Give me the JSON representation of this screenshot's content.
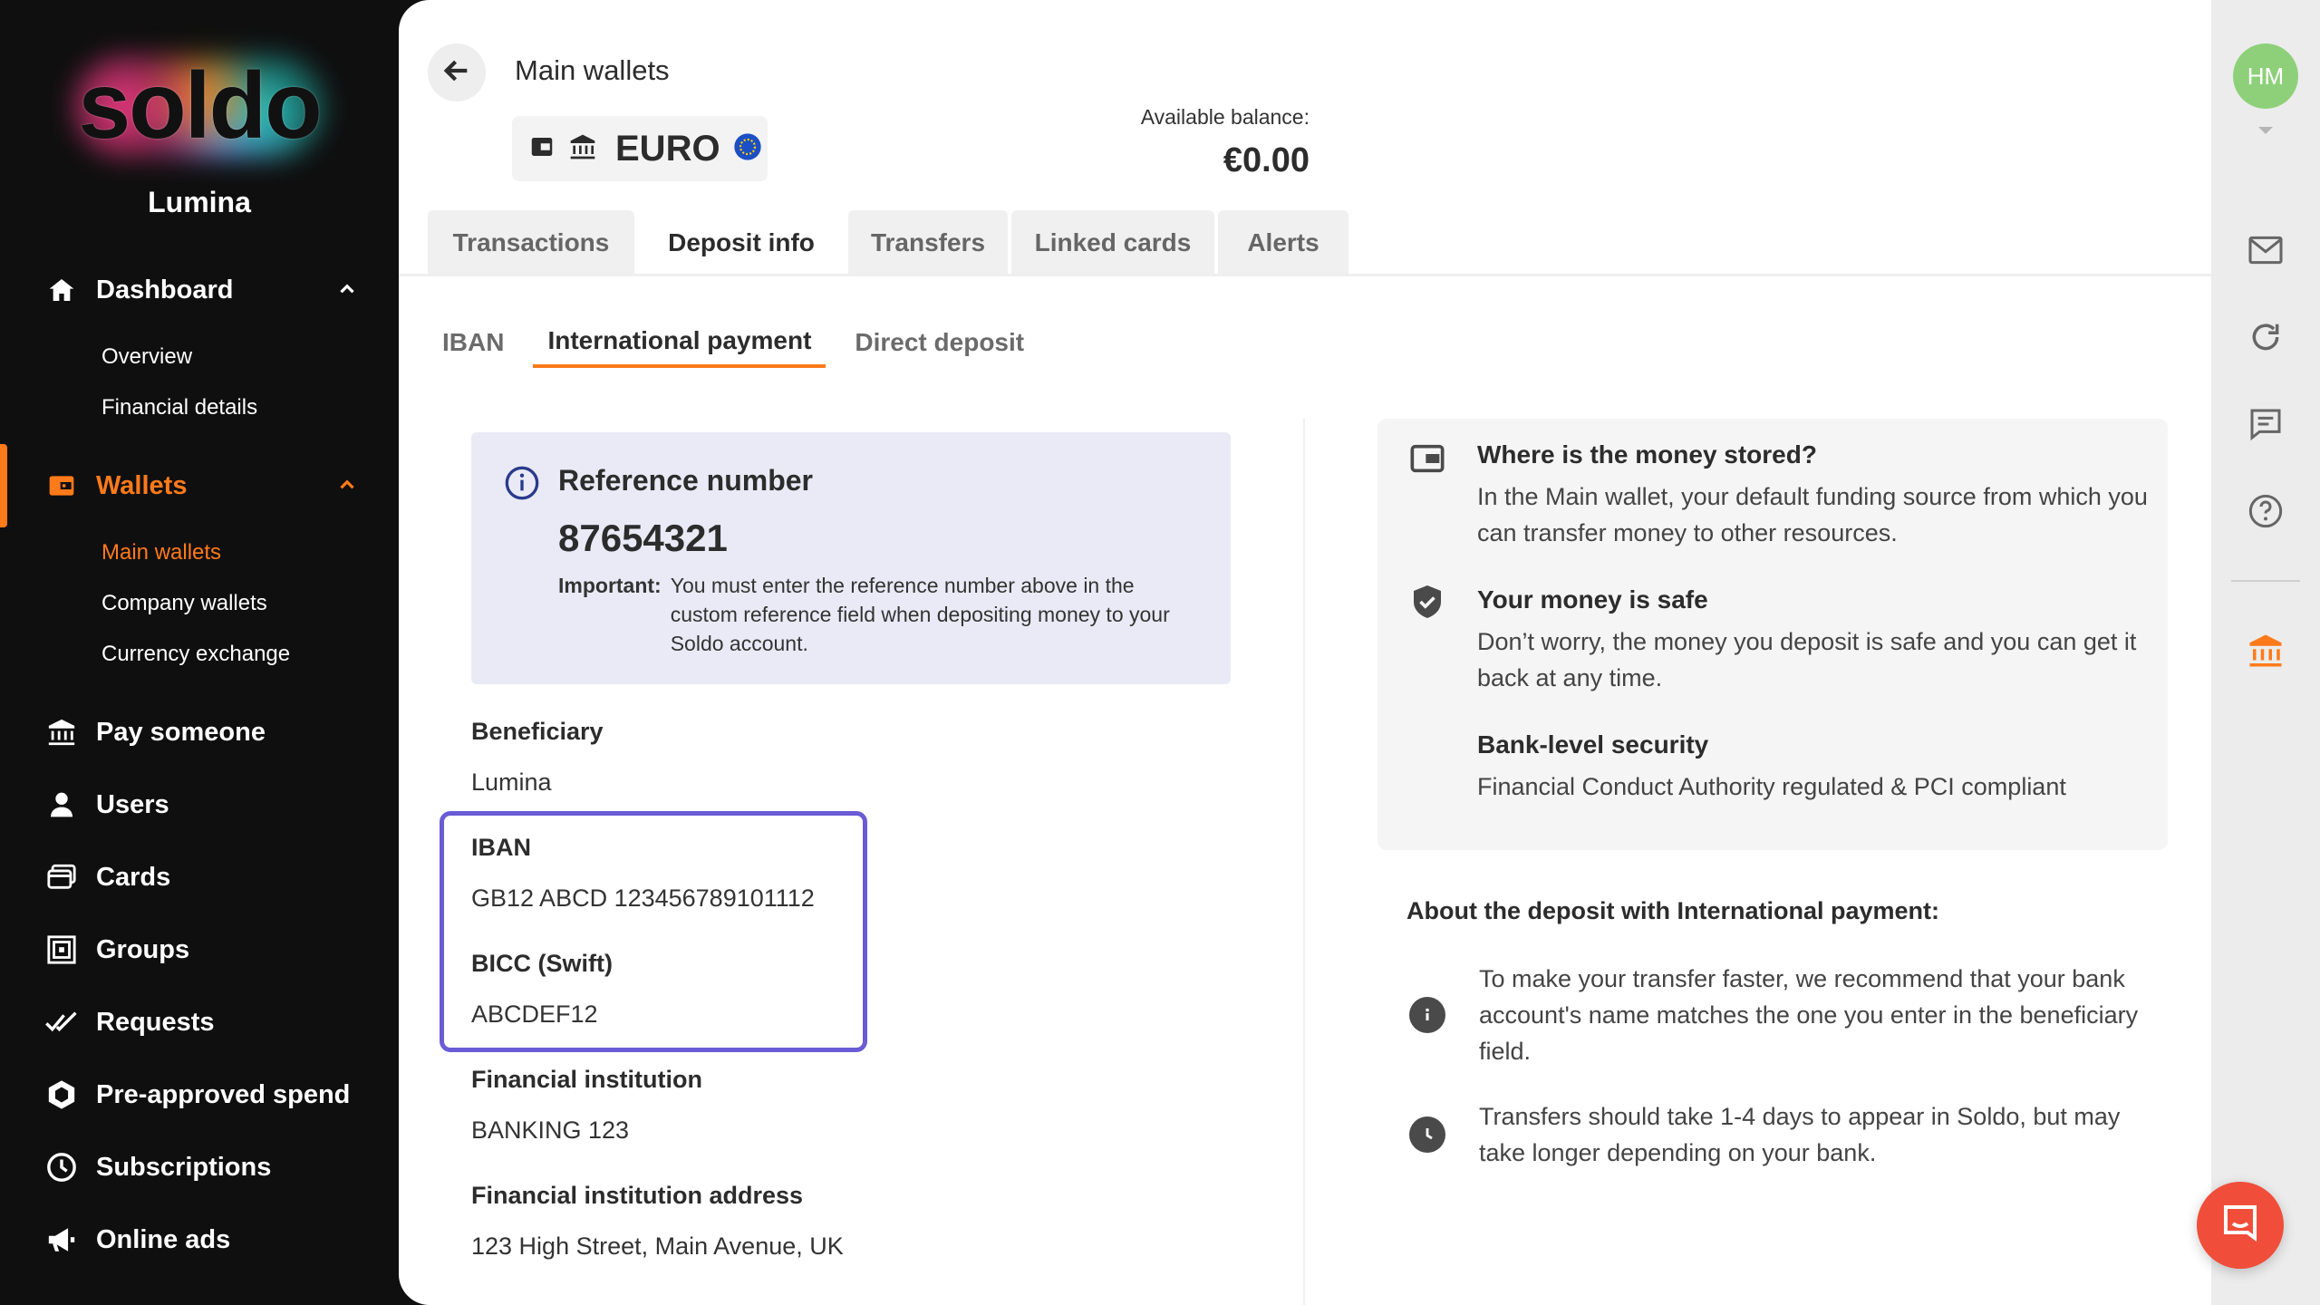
{
  "sidebar": {
    "logo": "soldo",
    "org_name": "Lumina",
    "items": [
      {
        "label": "Dashboard",
        "icon": "home-icon"
      },
      {
        "label": "Wallets",
        "icon": "wallet-icon"
      },
      {
        "label": "Pay someone",
        "icon": "bank-icon"
      },
      {
        "label": "Users",
        "icon": "user-icon"
      },
      {
        "label": "Cards",
        "icon": "cards-icon"
      },
      {
        "label": "Groups",
        "icon": "groups-icon"
      },
      {
        "label": "Requests",
        "icon": "double-check-icon"
      },
      {
        "label": "Pre-approved spend",
        "icon": "hexagon-icon"
      },
      {
        "label": "Subscriptions",
        "icon": "clock-icon"
      },
      {
        "label": "Online ads",
        "icon": "megaphone-icon"
      }
    ],
    "dashboard_sub": [
      "Overview",
      "Financial details"
    ],
    "wallets_sub": [
      "Main wallets",
      "Company wallets",
      "Currency exchange"
    ]
  },
  "header": {
    "title": "Main wallets",
    "wallet_name": "EURO",
    "balance_label": "Available balance:",
    "balance_value": "€0.00",
    "avatar_initials": "HM"
  },
  "tabs": [
    "Transactions",
    "Deposit info",
    "Transfers",
    "Linked cards",
    "Alerts"
  ],
  "active_tab": "Deposit info",
  "subtabs": [
    "IBAN",
    "International payment",
    "Direct deposit"
  ],
  "active_subtab": "International payment",
  "reference": {
    "title": "Reference number",
    "number": "87654321",
    "important_label": "Important:",
    "important_text": "You must enter the reference number above in the custom reference field when depositing money to your Soldo account."
  },
  "fields": {
    "beneficiary_label": "Beneficiary",
    "beneficiary_value": "Lumina",
    "iban_label": "IBAN",
    "iban_value": "GB12 ABCD 123456789101112",
    "bic_label": "BICC (Swift)",
    "bic_value": "ABCDEF12",
    "institution_label": "Financial institution",
    "institution_value": "BANKING 123",
    "address_label": "Financial institution address",
    "address_value": "123 High Street, Main Avenue, UK"
  },
  "info_card": [
    {
      "title": "Where is the money stored?",
      "text": "In the Main wallet, your default funding source from which you can transfer money to other resources."
    },
    {
      "title": "Your money is safe",
      "text": "Don’t worry, the money you deposit is safe and you can get it back at any time."
    },
    {
      "title": "Bank-level security",
      "text": "Financial Conduct Authority regulated & PCI compliant"
    }
  ],
  "about": {
    "title": "About the deposit with International payment:",
    "items": [
      "To make your transfer faster, we recommend that your bank account's name matches the one you enter in the beneficiary field.",
      "Transfers should take 1-4 days to appear in Soldo, but may take longer depending on your bank."
    ]
  },
  "colors": {
    "accent": "#ff7a1a",
    "highlight": "#6a5bd6",
    "sidebar_bg": "#0f0f0f"
  }
}
